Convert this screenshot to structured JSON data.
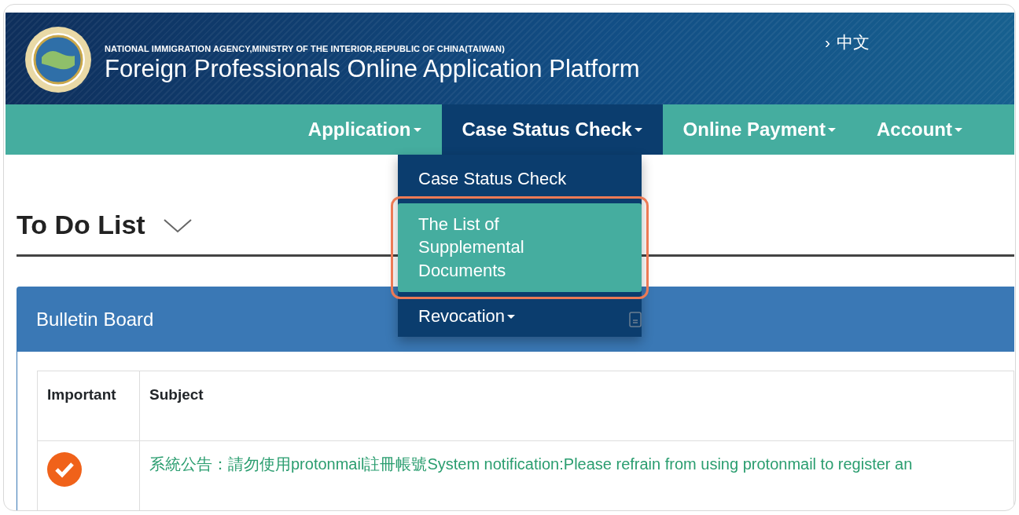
{
  "header": {
    "agency": "NATIONAL IMMIGRATION AGENCY,MINISTRY OF THE INTERIOR,REPUBLIC OF CHINA(TAIWAN)",
    "title": "Foreign Professionals Online Application Platform",
    "language_arrow": "›",
    "language_link": "中文"
  },
  "nav": [
    {
      "label": "Application",
      "selected": false
    },
    {
      "label": "Case Status Check",
      "selected": true
    },
    {
      "label": "Online Payment",
      "selected": false
    },
    {
      "label": "Account",
      "selected": false
    }
  ],
  "dropdown": {
    "items": [
      {
        "label": "Case Status Check",
        "highlighted": false,
        "has_submenu": false
      },
      {
        "label": "The List of Supplemental Documents",
        "highlighted": true,
        "has_submenu": false
      },
      {
        "label": "Revocation",
        "highlighted": false,
        "has_submenu": true
      }
    ]
  },
  "page": {
    "heading": "To Do List"
  },
  "bulletin": {
    "title": "Bulletin Board",
    "columns": [
      "Important",
      "Subject"
    ],
    "rows": [
      {
        "important": true,
        "subject": "系統公告：請勿使用protonmail註冊帳號System notification:Please refrain from using protonmail to register an"
      }
    ]
  }
}
